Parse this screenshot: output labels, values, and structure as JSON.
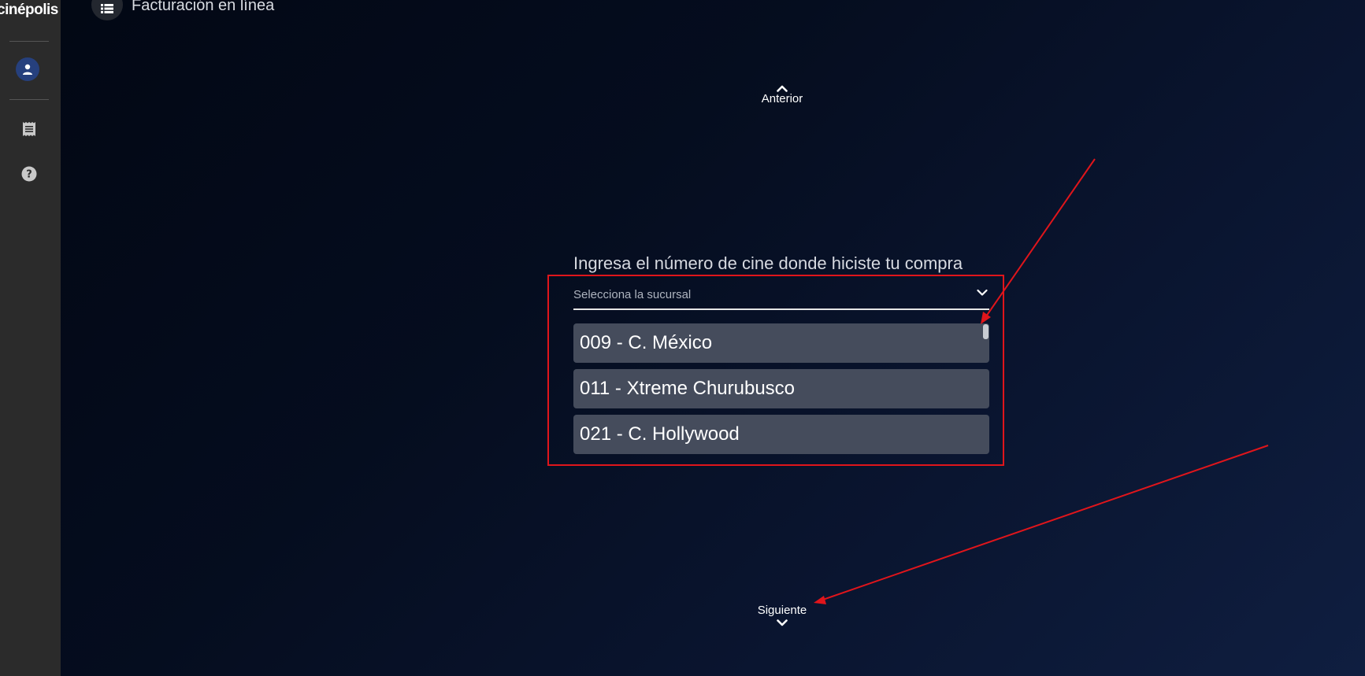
{
  "sidebar": {
    "logo": "cinépolis",
    "icons": [
      "user-icon",
      "receipt-icon",
      "help-icon"
    ]
  },
  "header": {
    "title": "Facturación en línea",
    "icon": "list-icon"
  },
  "nav": {
    "previous_label": "Anterior",
    "next_label": "Siguiente"
  },
  "form": {
    "question": "Ingresa el número de cine donde hiciste tu compra",
    "select": {
      "placeholder": "Selecciona la sucursal",
      "options": [
        "009 - C. México",
        "011 - Xtreme Churubusco",
        "021 - C. Hollywood"
      ]
    }
  },
  "colors": {
    "annotation": "#e0151b",
    "option_bg": "#454c5c",
    "sidebar_bg": "#2b2b2b",
    "avatar_bg": "#26407d"
  }
}
